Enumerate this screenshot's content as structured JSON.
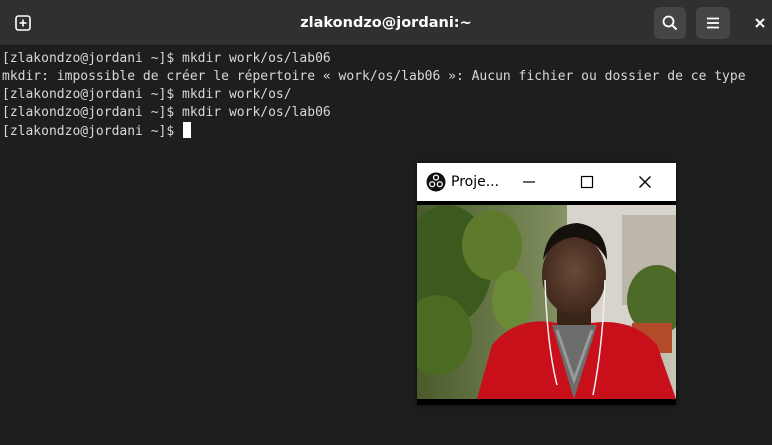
{
  "window": {
    "title": "zlakondzo@jordani:~"
  },
  "toolbar": {
    "new_tab_icon": "new-tab-icon",
    "search_icon": "search-icon",
    "menu_icon": "hamburger-menu-icon",
    "close_icon": "close-icon"
  },
  "terminal": {
    "lines": [
      "[zlakondzo@jordani ~]$ mkdir work/os/lab06",
      "mkdir: impossible de créer le répertoire « work/os/lab06 »: Aucun fichier ou dossier de ce type",
      "[zlakondzo@jordani ~]$ mkdir work/os/",
      "[zlakondzo@jordani ~]$ mkdir work/os/lab06",
      "[zlakondzo@jordani ~]$ "
    ]
  },
  "projector": {
    "title": "Proje...",
    "app_icon": "obs-logo-icon",
    "minimize_icon": "minimize-icon",
    "maximize_icon": "maximize-icon",
    "close_icon": "close-icon"
  },
  "colors": {
    "headerbar": "#303030",
    "terminal_bg": "#1e1e1e",
    "terminal_fg": "#d8d8d8",
    "button_bg": "#454545"
  }
}
